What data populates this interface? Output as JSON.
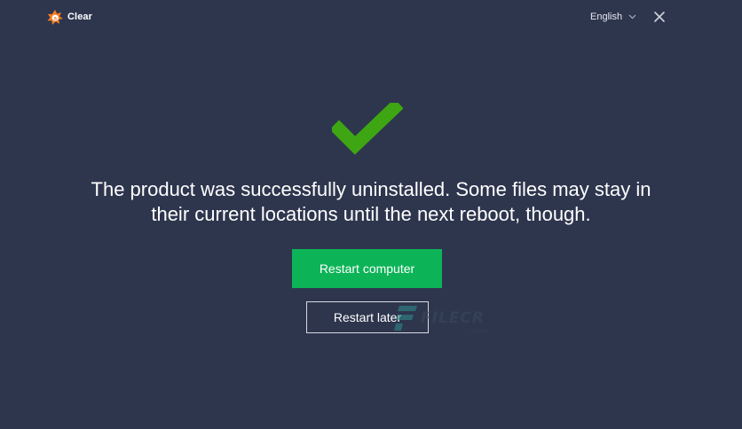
{
  "window": {
    "app_name": "Clear",
    "language": "English",
    "logo_icon": "avast-logo-icon",
    "close_icon": "close-icon"
  },
  "main": {
    "status_icon": "checkmark-icon",
    "message_line1": "The product was successfully uninstalled. Some files may stay in",
    "message_line2": "their current locations until the next reboot, though.",
    "primary_button": "Restart computer",
    "secondary_button": "Restart later"
  },
  "watermark": {
    "text": "FILECR",
    "subtext": ".com"
  },
  "colors": {
    "background": "#2e364e",
    "accent_green": "#0cb457",
    "check_green": "#3ea612",
    "brand_orange": "#f47c20"
  }
}
